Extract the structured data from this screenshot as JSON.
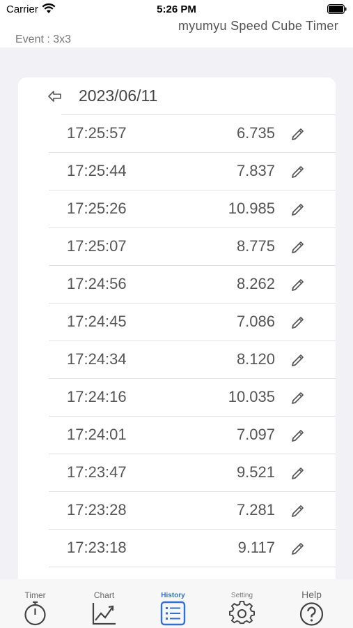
{
  "status_bar": {
    "carrier": "Carrier",
    "time": "5:26 PM"
  },
  "header": {
    "app_title": "myumyu Speed Cube Timer",
    "event": "Event : 3x3"
  },
  "history": {
    "date": "2023/06/11",
    "rows": [
      {
        "time": "17:25:57",
        "value": "6.735"
      },
      {
        "time": "17:25:44",
        "value": "7.837"
      },
      {
        "time": "17:25:26",
        "value": "10.985"
      },
      {
        "time": "17:25:07",
        "value": "8.775"
      },
      {
        "time": "17:24:56",
        "value": "8.262"
      },
      {
        "time": "17:24:45",
        "value": "7.086"
      },
      {
        "time": "17:24:34",
        "value": "8.120"
      },
      {
        "time": "17:24:16",
        "value": "10.035"
      },
      {
        "time": "17:24:01",
        "value": "7.097"
      },
      {
        "time": "17:23:47",
        "value": "9.521"
      },
      {
        "time": "17:23:28",
        "value": "7.281"
      },
      {
        "time": "17:23:18",
        "value": "9.117"
      }
    ]
  },
  "tabs": [
    {
      "label": "Timer",
      "icon": "stopwatch-icon"
    },
    {
      "label": "Chart",
      "icon": "line-chart-icon"
    },
    {
      "label": "History",
      "icon": "list-icon",
      "active": true
    },
    {
      "label": "Setting",
      "icon": "gear-icon"
    },
    {
      "label": "Help",
      "icon": "question-icon"
    }
  ],
  "colors": {
    "accent": "#2f6fd6",
    "background": "#f2f2f6",
    "card": "#ffffff"
  }
}
